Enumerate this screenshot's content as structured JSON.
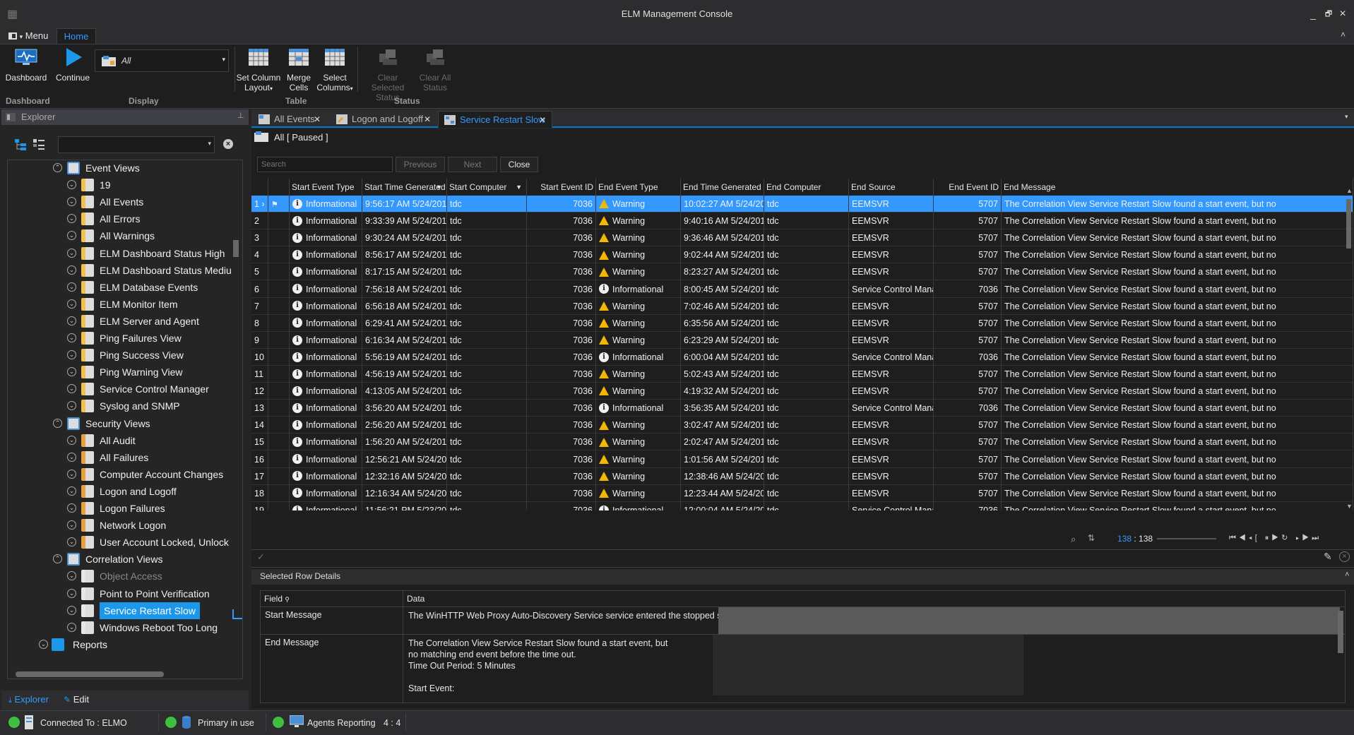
{
  "window": {
    "title": "ELM Management Console",
    "minimize": "_",
    "restore": "🗗",
    "close": "×"
  },
  "menu": {
    "menu_label": "Menu",
    "home_tab": "Home"
  },
  "ribbon": {
    "dashboard": "Dashboard",
    "continue": "Continue",
    "display_value": "All",
    "set_column_layout": [
      "Set Column",
      "Layout"
    ],
    "merge_cells": [
      "Merge",
      "Cells"
    ],
    "select_columns": [
      "Select",
      "Columns"
    ],
    "clear_selected_status": [
      "Clear Selected",
      "Status"
    ],
    "clear_all_status": [
      "Clear All",
      "Status"
    ],
    "groups": {
      "dashboard": "Dashboard",
      "display": "Display",
      "table": "Table",
      "status": "Status"
    }
  },
  "explorer": {
    "title": "Explorer",
    "bottom_tabs": [
      "Explorer",
      "Edit"
    ],
    "tree": [
      {
        "label": "Event Views",
        "level": 0,
        "expanded": true,
        "kind": "folder-events"
      },
      {
        "label": "19",
        "level": 1,
        "kind": "event"
      },
      {
        "label": "All  Events",
        "level": 1,
        "kind": "event"
      },
      {
        "label": "All Errors",
        "level": 1,
        "kind": "event"
      },
      {
        "label": "All Warnings",
        "level": 1,
        "kind": "event"
      },
      {
        "label": "ELM Dashboard Status High",
        "level": 1,
        "kind": "event"
      },
      {
        "label": "ELM Dashboard Status Mediu",
        "level": 1,
        "kind": "event"
      },
      {
        "label": "ELM Database Events",
        "level": 1,
        "kind": "event"
      },
      {
        "label": "ELM Monitor Item",
        "level": 1,
        "kind": "event"
      },
      {
        "label": "ELM Server and Agent",
        "level": 1,
        "kind": "event"
      },
      {
        "label": "Ping Failures View",
        "level": 1,
        "kind": "event"
      },
      {
        "label": "Ping Success View",
        "level": 1,
        "kind": "event"
      },
      {
        "label": "Ping Warning View",
        "level": 1,
        "kind": "event"
      },
      {
        "label": "Service Control Manager",
        "level": 1,
        "kind": "event"
      },
      {
        "label": "Syslog and SNMP",
        "level": 1,
        "kind": "event"
      },
      {
        "label": "Security Views",
        "level": 0,
        "expanded": true,
        "kind": "folder-security"
      },
      {
        "label": "All Audit",
        "level": 1,
        "kind": "security"
      },
      {
        "label": "All Failures",
        "level": 1,
        "kind": "security"
      },
      {
        "label": "Computer Account Changes",
        "level": 1,
        "kind": "security"
      },
      {
        "label": "Logon and Logoff",
        "level": 1,
        "kind": "security"
      },
      {
        "label": "Logon Failures",
        "level": 1,
        "kind": "security"
      },
      {
        "label": "Network Logon",
        "level": 1,
        "kind": "security"
      },
      {
        "label": "User Account Locked, Unlock",
        "level": 1,
        "kind": "security"
      },
      {
        "label": "Correlation Views",
        "level": 0,
        "expanded": true,
        "kind": "folder-correlation"
      },
      {
        "label": "Object Access",
        "level": 1,
        "kind": "correlation",
        "dim": true
      },
      {
        "label": "Point to Point Verification",
        "level": 1,
        "kind": "correlation"
      },
      {
        "label": "Service Restart Slow",
        "level": 1,
        "kind": "correlation",
        "selected": true
      },
      {
        "label": "Windows Reboot Too Long",
        "level": 1,
        "kind": "correlation"
      },
      {
        "label": "Reports",
        "level": -1,
        "kind": "folder-reports"
      }
    ]
  },
  "doc_tabs": [
    {
      "label": "All  Events",
      "active": false
    },
    {
      "label": "Logon and Logoff",
      "active": false
    },
    {
      "label": "Service Restart Slow",
      "active": true
    }
  ],
  "view": {
    "filter_label": "All  [ Paused ]",
    "search_placeholder": "Search",
    "previous": "Previous",
    "next": "Next",
    "close": "Close"
  },
  "grid": {
    "columns": [
      "Start Event Type",
      "Start Time Generated",
      "Start Computer",
      "Start Event ID",
      "End Event Type",
      "End Time Generated",
      "End Computer",
      "End Source",
      "End Event ID",
      "End Message"
    ],
    "rows": [
      [
        "1",
        "Informational",
        "9:56:17 AM 5/24/2019",
        "tdc",
        "7036",
        "Warning",
        "10:02:27 AM 5/24/20",
        "tdc",
        "EEMSVR",
        "5707",
        "The Correlation View Service Restart Slow found a start event, but no"
      ],
      [
        "2",
        "Informational",
        "9:33:39 AM 5/24/2019",
        "tdc",
        "7036",
        "Warning",
        "9:40:16 AM 5/24/201",
        "tdc",
        "EEMSVR",
        "5707",
        "The Correlation View Service Restart Slow found a start event, but no"
      ],
      [
        "3",
        "Informational",
        "9:30:24 AM 5/24/2019",
        "tdc",
        "7036",
        "Warning",
        "9:36:46 AM 5/24/201",
        "tdc",
        "EEMSVR",
        "5707",
        "The Correlation View Service Restart Slow found a start event, but no"
      ],
      [
        "4",
        "Informational",
        "8:56:17 AM 5/24/2019",
        "tdc",
        "7036",
        "Warning",
        "9:02:44 AM 5/24/201",
        "tdc",
        "EEMSVR",
        "5707",
        "The Correlation View Service Restart Slow found a start event, but no"
      ],
      [
        "5",
        "Informational",
        "8:17:15 AM 5/24/2019",
        "tdc",
        "7036",
        "Warning",
        "8:23:27 AM 5/24/201",
        "tdc",
        "EEMSVR",
        "5707",
        "The Correlation View Service Restart Slow found a start event, but no"
      ],
      [
        "6",
        "Informational",
        "7:56:18 AM 5/24/2019",
        "tdc",
        "7036",
        "Informational",
        "8:00:45 AM 5/24/201",
        "tdc",
        "Service Control Mana",
        "7036",
        "The Correlation View Service Restart Slow found a start event, but no"
      ],
      [
        "7",
        "Informational",
        "6:56:18 AM 5/24/2019",
        "tdc",
        "7036",
        "Warning",
        "7:02:46 AM 5/24/201",
        "tdc",
        "EEMSVR",
        "5707",
        "The Correlation View Service Restart Slow found a start event, but no"
      ],
      [
        "8",
        "Informational",
        "6:29:41 AM 5/24/2019",
        "tdc",
        "7036",
        "Warning",
        "6:35:56 AM 5/24/201",
        "tdc",
        "EEMSVR",
        "5707",
        "The Correlation View Service Restart Slow found a start event, but no"
      ],
      [
        "9",
        "Informational",
        "6:16:34 AM 5/24/2019",
        "tdc",
        "7036",
        "Warning",
        "6:23:29 AM 5/24/201",
        "tdc",
        "EEMSVR",
        "5707",
        "The Correlation View Service Restart Slow found a start event, but no"
      ],
      [
        "10",
        "Informational",
        "5:56:19 AM 5/24/2019",
        "tdc",
        "7036",
        "Informational",
        "6:00:04 AM 5/24/201",
        "tdc",
        "Service Control Mana",
        "7036",
        "The Correlation View Service Restart Slow found a start event, but no"
      ],
      [
        "11",
        "Informational",
        "4:56:19 AM 5/24/2019",
        "tdc",
        "7036",
        "Warning",
        "5:02:43 AM 5/24/201",
        "tdc",
        "EEMSVR",
        "5707",
        "The Correlation View Service Restart Slow found a start event, but no"
      ],
      [
        "12",
        "Informational",
        "4:13:05 AM 5/24/2019",
        "tdc",
        "7036",
        "Warning",
        "4:19:32 AM 5/24/201",
        "tdc",
        "EEMSVR",
        "5707",
        "The Correlation View Service Restart Slow found a start event, but no"
      ],
      [
        "13",
        "Informational",
        "3:56:20 AM 5/24/2019",
        "tdc",
        "7036",
        "Informational",
        "3:56:35 AM 5/24/201",
        "tdc",
        "Service Control Mana",
        "7036",
        "The Correlation View Service Restart Slow found a start event, but no"
      ],
      [
        "14",
        "Informational",
        "2:56:20 AM 5/24/2019",
        "tdc",
        "7036",
        "Warning",
        "3:02:47 AM 5/24/201",
        "tdc",
        "EEMSVR",
        "5707",
        "The Correlation View Service Restart Slow found a start event, but no"
      ],
      [
        "15",
        "Informational",
        "1:56:20 AM 5/24/2019",
        "tdc",
        "7036",
        "Warning",
        "2:02:47 AM 5/24/201",
        "tdc",
        "EEMSVR",
        "5707",
        "The Correlation View Service Restart Slow found a start event, but no"
      ],
      [
        "16",
        "Informational",
        "12:56:21 AM 5/24/2019",
        "tdc",
        "7036",
        "Warning",
        "1:01:56 AM 5/24/201",
        "tdc",
        "EEMSVR",
        "5707",
        "The Correlation View Service Restart Slow found a start event, but no"
      ],
      [
        "17",
        "Informational",
        "12:32:16 AM 5/24/2019",
        "tdc",
        "7036",
        "Warning",
        "12:38:46 AM 5/24/20",
        "tdc",
        "EEMSVR",
        "5707",
        "The Correlation View Service Restart Slow found a start event, but no"
      ],
      [
        "18",
        "Informational",
        "12:16:34 AM 5/24/2019",
        "tdc",
        "7036",
        "Warning",
        "12:23:44 AM 5/24/20",
        "tdc",
        "EEMSVR",
        "5707",
        "The Correlation View Service Restart Slow found a start event, but no"
      ],
      [
        "19",
        "Informational",
        "11:56:21 PM 5/23/2019",
        "tdc",
        "7036",
        "Informational",
        "12:00:04 AM 5/24/20",
        "tdc",
        "Service Control Mana",
        "7036",
        "The Correlation View Service Restart Slow found a start event, but no"
      ]
    ]
  },
  "pager": {
    "current": "138",
    "separator": " : ",
    "total": "138"
  },
  "details": {
    "title": "Selected Row Details",
    "field_header": "Field",
    "data_header": "Data",
    "start_message_label": "Start Message",
    "start_message": "The WinHTTP Web Proxy Auto-Discovery Service service entered the stopped state.",
    "end_message_label": "End Message",
    "end_message_lines": [
      "The Correlation View Service Restart Slow found a start event, but",
      "no matching end event before the time out.",
      "Time Out Period: 5 Minutes",
      "",
      "Start Event:"
    ]
  },
  "status": {
    "connected": "Connected To : ELMO",
    "primary": "Primary in use",
    "agents": "Agents Reporting",
    "agents_count": "4 : 4"
  },
  "colors": {
    "accent": "#3399ff",
    "selection": "#3399ff",
    "tree_selection": "#1c97ea",
    "ok": "#3fbf3f",
    "warning": "#f2b705"
  }
}
